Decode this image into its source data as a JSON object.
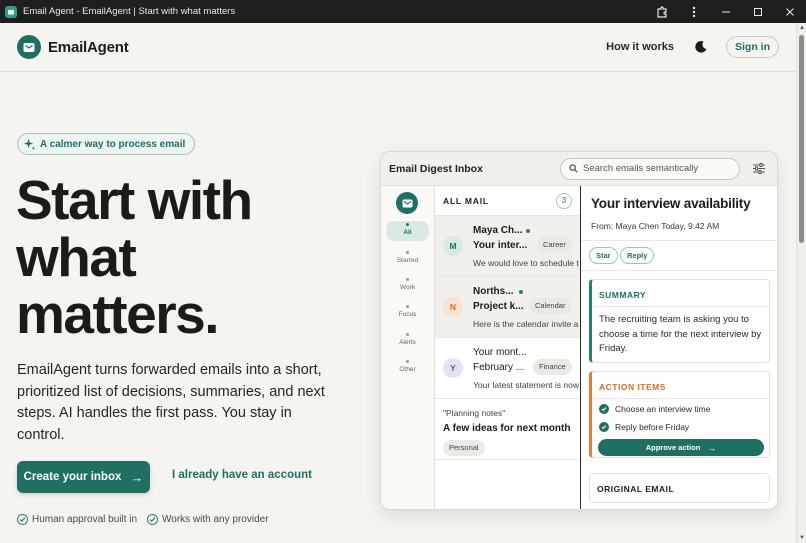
{
  "window": {
    "title": "Email Agent - EmailAgent | Start with what matters"
  },
  "header": {
    "brand": "EmailAgent",
    "nav_link": "How it works",
    "sign_in": "Sign in"
  },
  "hero": {
    "pill": "A calmer way to process email",
    "title_lines": [
      "Start with",
      "what",
      "matters."
    ],
    "description": "EmailAgent turns forwarded emails into a short, prioritized list of decisions, summaries, and next steps. AI handles the first pass. You stay in control.",
    "cta_primary": "Create your inbox",
    "cta_secondary": "I already have an account",
    "features": [
      "Human approval built in",
      "Works with any provider"
    ]
  },
  "mock": {
    "title": "Email Digest Inbox",
    "search_placeholder": "Search emails semantically",
    "rail": [
      "All",
      "Starred",
      "Work",
      "Focus",
      "Alerts",
      "Other"
    ],
    "list": {
      "label": "ALL MAIL",
      "count": "3",
      "rows": [
        {
          "initial": "M",
          "sender": "Maya Ch...",
          "subject": "Your inter...",
          "tag": "Career",
          "preview": "We would love to schedule t"
        },
        {
          "initial": "N",
          "sender": "Norths...",
          "subject": "Project k...",
          "tag": "Calendar",
          "preview": "Here is the calendar invite a"
        },
        {
          "initial": "Y",
          "sender": "Your mont...",
          "subject": "February ...",
          "tag": "Finance",
          "preview": "Your latest statement is now"
        }
      ],
      "note": {
        "label": "\"Planning notes\"",
        "title": "A few ideas for next month",
        "tag": "Personal"
      }
    },
    "detail": {
      "title": "Your interview availability",
      "from": "From: Maya Chen   Today, 9:42 AM",
      "buttons": [
        "Star",
        "Reply"
      ],
      "summary_header": "SUMMARY",
      "summary_text": "The recruiting team is asking you to choose a time for the next interview by Friday.",
      "actions_header": "ACTION ITEMS",
      "actions": [
        "Choose an interview time",
        "Reply before Friday"
      ],
      "approve": "Approve action",
      "original_header": "ORIGINAL EMAIL"
    }
  },
  "colors": {
    "accent": "#1f6f63",
    "background": "#f6f4ef",
    "action_orange": "#d86a27"
  }
}
